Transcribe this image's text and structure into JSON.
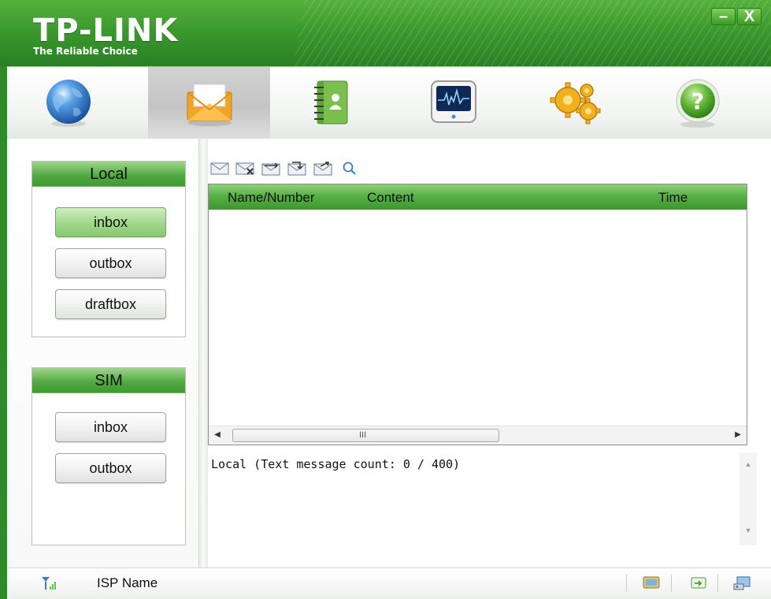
{
  "window": {
    "brand": "TP-LINK",
    "tagline": "The Reliable Choice",
    "minimize_label": "–",
    "close_label": "X"
  },
  "toolbar": {
    "items": [
      {
        "icon": "globe-icon",
        "active": false
      },
      {
        "icon": "envelope-icon",
        "active": true
      },
      {
        "icon": "contacts-book-icon",
        "active": false
      },
      {
        "icon": "monitor-waveform-icon",
        "active": false
      },
      {
        "icon": "gears-icon",
        "active": false
      },
      {
        "icon": "help-icon",
        "active": false
      }
    ]
  },
  "sidebar": {
    "local": {
      "title": "Local",
      "buttons": [
        "inbox",
        "outbox",
        "draftbox"
      ],
      "selected": "inbox"
    },
    "sim": {
      "title": "SIM",
      "buttons": [
        "inbox",
        "outbox"
      ]
    }
  },
  "messages": {
    "tools": [
      "new-message-icon",
      "delete-message-icon",
      "reply-message-icon",
      "forward-message-icon",
      "move-message-icon",
      "search-icon"
    ],
    "columns": [
      "Name/Number",
      "Content",
      "Time"
    ],
    "rows": [],
    "scroll_grip": "III",
    "status_text": "Local (Text message count: 0 / 400)"
  },
  "statusbar": {
    "isp_label": "ISP Name",
    "icons": [
      "signal-icon",
      "sms-indicator-icon",
      "connection-icon",
      "device-icon"
    ]
  },
  "colors": {
    "accent_green": "#3f9a32",
    "title_green": "#2a7f24"
  }
}
